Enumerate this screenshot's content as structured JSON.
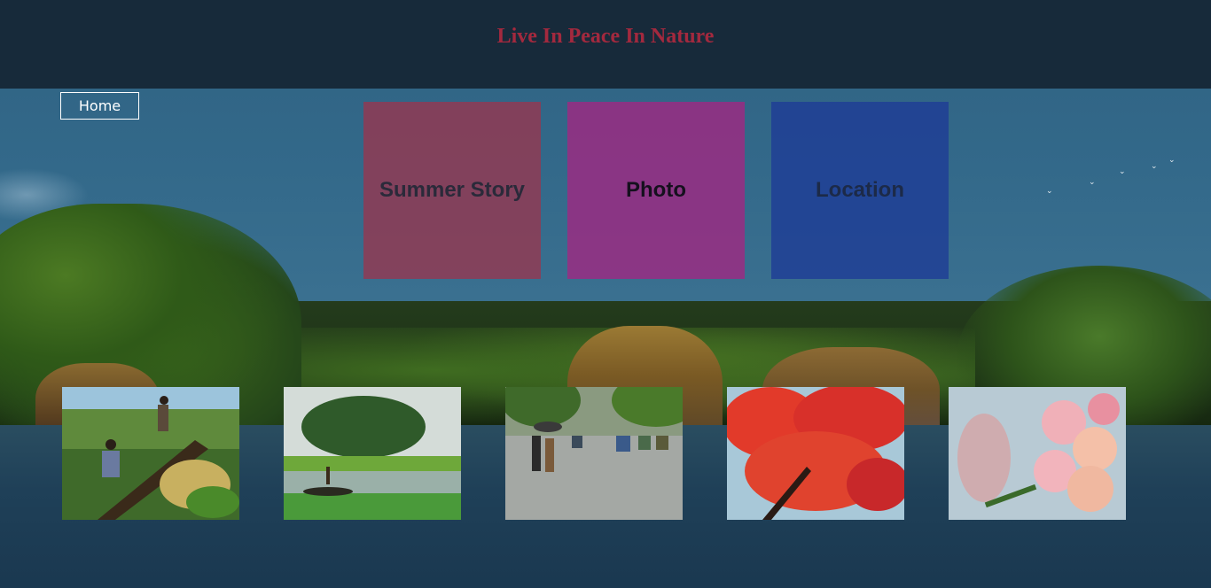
{
  "header": {
    "title": "Live In Peace In Nature"
  },
  "nav": {
    "home_label": "Home"
  },
  "tiles": [
    {
      "label": "Summer Story",
      "color": "#963750"
    },
    {
      "label": "Photo",
      "color": "#a02882"
    },
    {
      "label": "Location",
      "color": "#1e3c96"
    }
  ],
  "gallery": {
    "images": [
      {
        "subject": "fisherman-boat-photo"
      },
      {
        "subject": "river-landscape-photo"
      },
      {
        "subject": "rainy-street-photo"
      },
      {
        "subject": "red-flower-tree-photo"
      },
      {
        "subject": "pink-flowers-photo"
      }
    ]
  },
  "colors": {
    "header_bg": "#172a3a",
    "title": "#a3293e"
  }
}
